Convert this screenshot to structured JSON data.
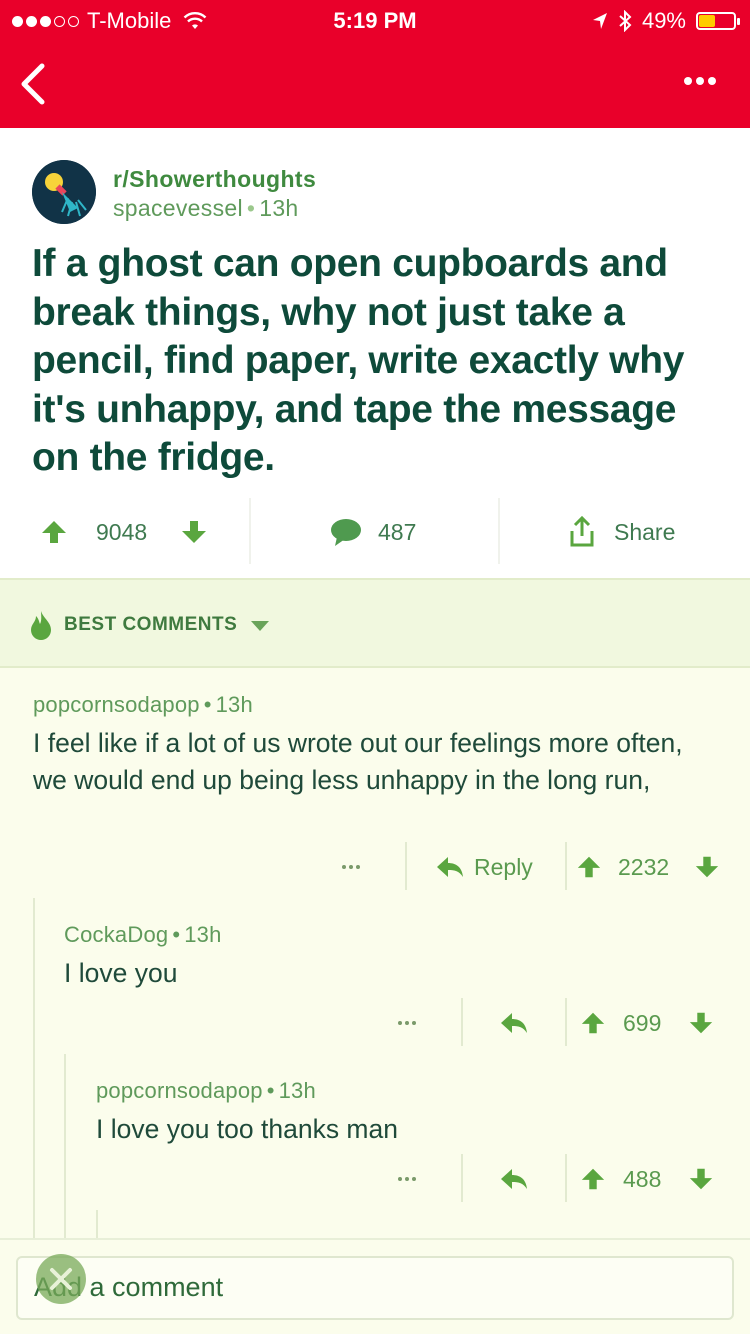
{
  "status_bar": {
    "carrier": "T-Mobile",
    "time": "5:19 PM",
    "battery": "49%",
    "battery_level": 0.49
  },
  "colors": {
    "header": "#e9002a",
    "title": "#0e4a3a",
    "accent_green": "#3f8a3f",
    "comment_bg": "#fbfdec"
  },
  "nav": {
    "back_icon": "chevron-left-icon",
    "more_icon": "more-dots-icon"
  },
  "post": {
    "subreddit": "r/Showerthoughts",
    "author": "spacevessel",
    "age": "13h",
    "title": "If a ghost can open cupboards and break things, why not just take a pencil, find paper, write exactly why it's unhappy, and tape the message on the fridge.",
    "score": "9048",
    "comments": "487",
    "share": "Share"
  },
  "sort": {
    "label": "BEST COMMENTS"
  },
  "comments": [
    {
      "author": "popcornsodapop",
      "age": "13h",
      "body": "I feel like if a lot of us wrote out our feelings more often, we would end up being less unhappy in the long run,",
      "reply": "Reply",
      "score": "2232"
    },
    {
      "author": "CockaDog",
      "age": "13h",
      "body": "I love you",
      "score": "699"
    },
    {
      "author": "popcornsodapop",
      "age": "13h",
      "body": "I love you too thanks man",
      "score": "488"
    }
  ],
  "composer": {
    "placeholder": "Add a comment"
  }
}
